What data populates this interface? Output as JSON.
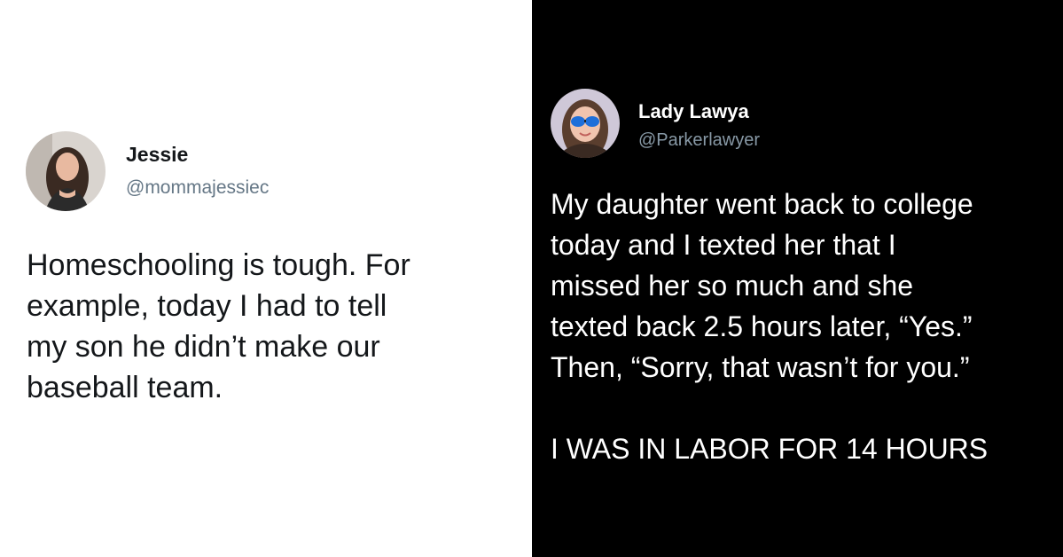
{
  "left_tweet": {
    "display_name": "Jessie",
    "handle": "@mommajessiec",
    "text": "Homeschooling is tough. For\nexample, today I had to tell\nmy son he didn’t make our\nbaseball team.",
    "avatar_icon": "profile-photo-icon"
  },
  "right_tweet": {
    "display_name": "Lady Lawya",
    "handle": "@Parkerlawyer",
    "text": "My daughter went back to college\ntoday and I texted her that I\nmissed her so much and she\ntexted back 2.5 hours later, “Yes.”\nThen, “Sorry, that wasn’t for you.”\n\nI WAS IN LABOR FOR 14 HOURS",
    "avatar_icon": "profile-photo-icon"
  },
  "colors": {
    "left_background": "#ffffff",
    "right_background": "#000000",
    "left_text": "#14171a",
    "left_handle": "#657786",
    "right_text": "#ffffff",
    "right_handle": "#8899a6"
  }
}
